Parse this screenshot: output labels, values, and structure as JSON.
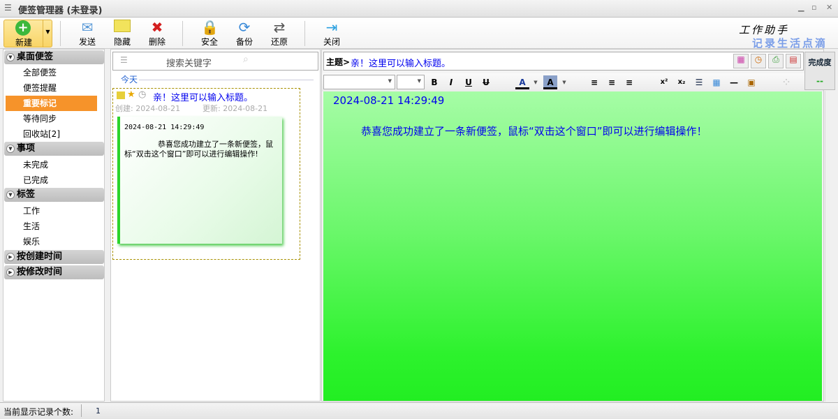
{
  "window": {
    "title": "便签管理器 (未登录)"
  },
  "toolbar": {
    "new": "新建",
    "send": "发送",
    "hide": "隐藏",
    "delete": "删除",
    "security": "安全",
    "backup": "备份",
    "restore": "还原",
    "close": "关闭",
    "logo_line1": "工作助手",
    "logo_line2": "记录生活点滴"
  },
  "sidebar": {
    "groups": [
      {
        "label": "桌面便签",
        "items": [
          "全部便签",
          "便签提醒",
          "重要标记",
          "等待同步",
          "回收站[2]"
        ]
      },
      {
        "label": "事项",
        "items": [
          "未完成",
          "已完成"
        ]
      },
      {
        "label": "标签",
        "items": [
          "工作",
          "生活",
          "娱乐"
        ]
      },
      {
        "label": "按创建时间"
      },
      {
        "label": "按修改时间"
      }
    ],
    "selected": "重要标记"
  },
  "list": {
    "search_placeholder": "搜索关键字",
    "section": "今天",
    "note": {
      "title": "亲！这里可以输入标题。",
      "created": "创建: 2024-08-21",
      "updated": "更新: 2024-08-21",
      "preview_time": "2024-08-21 14:29:49",
      "preview_text": "恭喜您成功建立了一条新便签，鼠标“双击这个窗口”即可以进行编辑操作!"
    }
  },
  "editor": {
    "subject_label": "主题>",
    "subject": "亲！这里可以输入标题。",
    "complete_label": "完成度",
    "complete_value": "--",
    "time": "2024-08-21 14:29:49",
    "body": "恭喜您成功建立了一条新便签，鼠标“双击这个窗口”即可以进行编辑操作！"
  },
  "status": {
    "label": "当前显示记录个数:",
    "count": "1"
  },
  "colors": {
    "accent": "#f6932a",
    "note_green": "#2df22d",
    "link_blue": "#0000ee"
  }
}
